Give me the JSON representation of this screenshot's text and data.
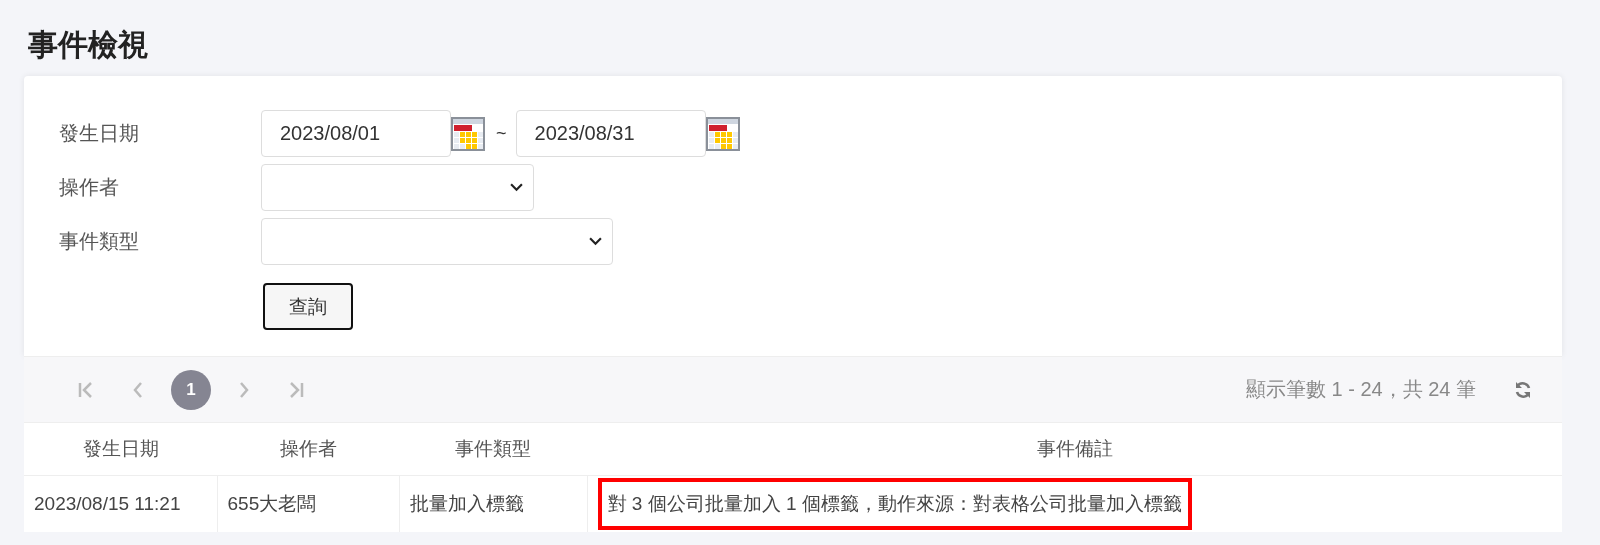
{
  "page_title": "事件檢視",
  "filters": [
    {
      "kind": "daterange",
      "label": "發生日期",
      "from": "2023/08/01",
      "separator": "~",
      "to": "2023/08/31"
    },
    {
      "kind": "select",
      "label": "操作者"
    },
    {
      "kind": "select",
      "label": "事件類型"
    }
  ],
  "query_button": "查詢",
  "pager": {
    "pages": [
      {
        "label": "1",
        "selected": true
      }
    ],
    "summary": "顯示筆數 1 - 24，共 24 筆"
  },
  "table": {
    "columns": [
      "發生日期",
      "操作者",
      "事件類型",
      "事件備註"
    ],
    "rows": [
      {
        "cells": [
          "2023/08/15 11:21",
          "655大老闆",
          "批量加入標籤",
          "對 3 個公司批量加入 1 個標籤，動作來源：對表格公司批量加入標籤"
        ],
        "highlighted": true
      }
    ]
  }
}
